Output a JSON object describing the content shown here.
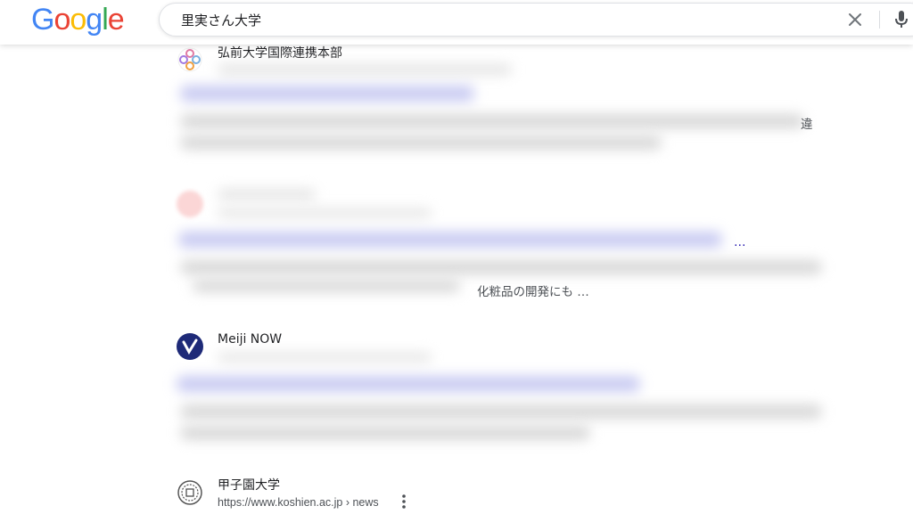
{
  "header": {
    "logo_letters": [
      {
        "ch": "G",
        "color": "#4285F4"
      },
      {
        "ch": "o",
        "color": "#EA4335"
      },
      {
        "ch": "o",
        "color": "#FBBC05"
      },
      {
        "ch": "g",
        "color": "#4285F4"
      },
      {
        "ch": "l",
        "color": "#34A853"
      },
      {
        "ch": "e",
        "color": "#EA4335"
      }
    ],
    "search_query": "里実さん大学",
    "clear_icon": "close-icon",
    "mic_icon": "microphone-icon"
  },
  "results": [
    {
      "site_name": "弘前大学国際連携本部",
      "snippet_fragment": "違",
      "favicon": "flower-logo-icon"
    },
    {
      "site_name": "",
      "title_tail": "…",
      "snippet_fragment": "化粧品の開発にも …",
      "favicon": "red-logo-icon"
    },
    {
      "site_name": "Meiji NOW",
      "favicon": "meiji-v-logo-icon"
    },
    {
      "site_name": "甲子園大学",
      "url": "https://www.koshien.ac.jp › news",
      "favicon": "koshien-emblem-icon",
      "menu_icon": "more-vert-icon"
    }
  ]
}
